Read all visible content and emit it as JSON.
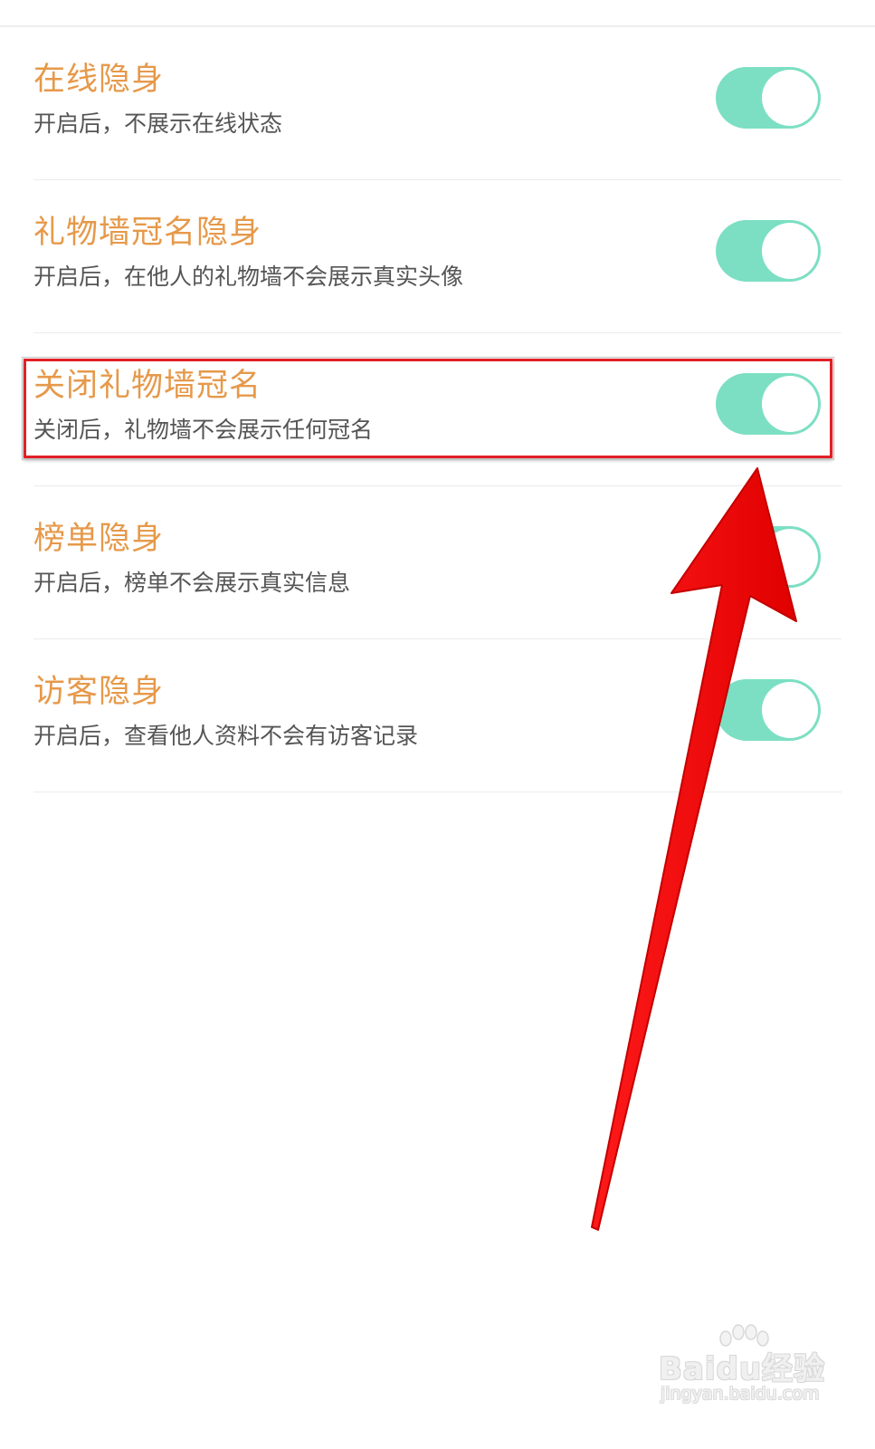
{
  "settings": [
    {
      "title": "在线隐身",
      "description": "开启后，不展示在线状态",
      "enabled": true
    },
    {
      "title": "礼物墙冠名隐身",
      "description": "开启后，在他人的礼物墙不会展示真实头像",
      "enabled": true
    },
    {
      "title": "关闭礼物墙冠名",
      "description": "关闭后，礼物墙不会展示任何冠名",
      "enabled": true
    },
    {
      "title": "榜单隐身",
      "description": "开启后，榜单不会展示真实信息",
      "enabled": true
    },
    {
      "title": "访客隐身",
      "description": "开启后，查看他人资料不会有访客记录",
      "enabled": true
    }
  ],
  "watermark": {
    "brand": "Baidu经验",
    "url": "jingyan.baidu.com"
  },
  "colors": {
    "title": "#e6994a",
    "description": "#555555",
    "toggle_on": "#7cdfc3",
    "annotation_red": "#e21f26"
  }
}
